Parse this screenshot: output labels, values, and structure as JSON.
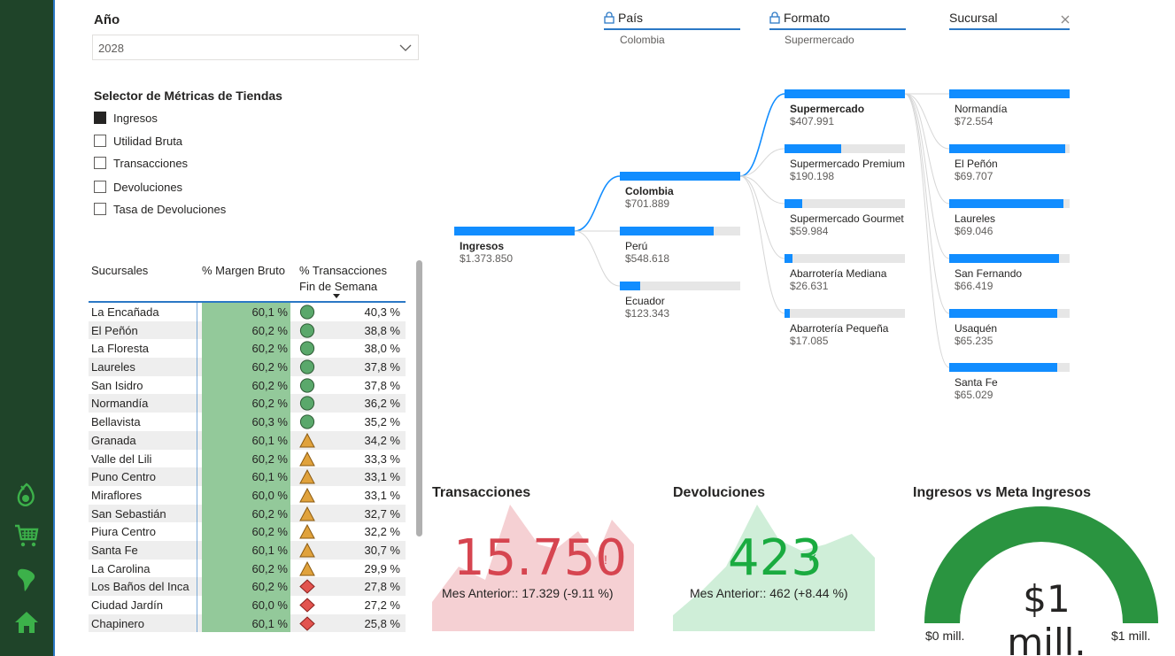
{
  "nav": {
    "items": [
      {
        "name": "avocado-icon"
      },
      {
        "name": "cart-icon"
      },
      {
        "name": "map-south-america-icon"
      },
      {
        "name": "home-icon"
      }
    ]
  },
  "year_filter": {
    "label": "Año",
    "value": "2028"
  },
  "metric_selector": {
    "title": "Selector de Métricas de Tiendas",
    "items": [
      {
        "label": "Ingresos",
        "checked": true
      },
      {
        "label": "Utilidad Bruta",
        "checked": false
      },
      {
        "label": "Transacciones",
        "checked": false
      },
      {
        "label": "Devoluciones",
        "checked": false
      },
      {
        "label": "Tasa de Devoluciones",
        "checked": false
      }
    ]
  },
  "table": {
    "headers": {
      "col1": "Sucursales",
      "col2": "% Margen Bruto",
      "col3a": "% Transacciones",
      "col3b": "Fin de Semana"
    },
    "rows": [
      {
        "name": "La Encañada",
        "margin": "60,1 %",
        "status": "circle",
        "weekend": "40,3 %"
      },
      {
        "name": "El Peñón",
        "margin": "60,2 %",
        "status": "circle",
        "weekend": "38,8 %"
      },
      {
        "name": "La Floresta",
        "margin": "60,2 %",
        "status": "circle",
        "weekend": "38,0 %"
      },
      {
        "name": "Laureles",
        "margin": "60,2 %",
        "status": "circle",
        "weekend": "37,8 %"
      },
      {
        "name": "San Isidro",
        "margin": "60,2 %",
        "status": "circle",
        "weekend": "37,8 %"
      },
      {
        "name": "Normandía",
        "margin": "60,2 %",
        "status": "circle",
        "weekend": "36,2 %"
      },
      {
        "name": "Bellavista",
        "margin": "60,3 %",
        "status": "circle",
        "weekend": "35,2 %"
      },
      {
        "name": "Granada",
        "margin": "60,1 %",
        "status": "triangle",
        "weekend": "34,2 %"
      },
      {
        "name": "Valle del Lili",
        "margin": "60,2 %",
        "status": "triangle",
        "weekend": "33,3 %"
      },
      {
        "name": "Puno Centro",
        "margin": "60,1 %",
        "status": "triangle",
        "weekend": "33,1 %"
      },
      {
        "name": "Miraflores",
        "margin": "60,0 %",
        "status": "triangle",
        "weekend": "33,1 %"
      },
      {
        "name": "San Sebastián",
        "margin": "60,2 %",
        "status": "triangle",
        "weekend": "32,7 %"
      },
      {
        "name": "Piura Centro",
        "margin": "60,2 %",
        "status": "triangle",
        "weekend": "32,2 %"
      },
      {
        "name": "Santa Fe",
        "margin": "60,1 %",
        "status": "triangle",
        "weekend": "30,7 %"
      },
      {
        "name": "La Carolina",
        "margin": "60,2 %",
        "status": "triangle",
        "weekend": "29,9 %"
      },
      {
        "name": "Los Baños del Inca",
        "margin": "60,2 %",
        "status": "diamond",
        "weekend": "27,8 %"
      },
      {
        "name": "Ciudad Jardín",
        "margin": "60,0 %",
        "status": "diamond",
        "weekend": "27,2 %"
      },
      {
        "name": "Chapinero",
        "margin": "60,1 %",
        "status": "diamond",
        "weekend": "25,8 %"
      }
    ]
  },
  "tree": {
    "levels": [
      {
        "title": "País",
        "locked": true,
        "sub": "Colombia"
      },
      {
        "title": "Formato",
        "locked": true,
        "sub": "Supermercado"
      },
      {
        "title": "Sucursal",
        "locked": false,
        "sub": ""
      }
    ],
    "root": {
      "label": "Ingresos",
      "value": "$1.373.850",
      "fraction": 1.0
    },
    "countries": [
      {
        "label": "Colombia",
        "value": "$701.889",
        "fraction": 1.0,
        "selected": true
      },
      {
        "label": "Perú",
        "value": "$548.618",
        "fraction": 0.78,
        "selected": false
      },
      {
        "label": "Ecuador",
        "value": "$123.343",
        "fraction": 0.17,
        "selected": false
      }
    ],
    "formats": [
      {
        "label": "Supermercado",
        "value": "$407.991",
        "fraction": 1.0,
        "selected": true
      },
      {
        "label": "Supermercado Premium",
        "value": "$190.198",
        "fraction": 0.47,
        "selected": false
      },
      {
        "label": "Supermercado Gourmet",
        "value": "$59.984",
        "fraction": 0.15,
        "selected": false
      },
      {
        "label": "Abarrotería Mediana",
        "value": "$26.631",
        "fraction": 0.065,
        "selected": false
      },
      {
        "label": "Abarrotería Pequeña",
        "value": "$17.085",
        "fraction": 0.042,
        "selected": false
      }
    ],
    "stores": [
      {
        "label": "Normandía",
        "value": "$72.554",
        "fraction": 1.0
      },
      {
        "label": "El Peñón",
        "value": "$69.707",
        "fraction": 0.96
      },
      {
        "label": "Laureles",
        "value": "$69.046",
        "fraction": 0.95
      },
      {
        "label": "San Fernando",
        "value": "$66.419",
        "fraction": 0.915
      },
      {
        "label": "Usaquén",
        "value": "$65.235",
        "fraction": 0.9
      },
      {
        "label": "Santa Fe",
        "value": "$65.029",
        "fraction": 0.895
      }
    ]
  },
  "kpis": {
    "transacciones": {
      "title": "Transacciones",
      "value": "15.750",
      "mark": "!",
      "sub": "Mes Anterior:: 17.329 (-9.11 %)",
      "color": "#d64550",
      "bg": "#f5d0d3"
    },
    "devoluciones": {
      "title": "Devoluciones",
      "value": "423",
      "mark": "✓",
      "sub": "Mes Anterior:: 462 (+8.44 %)",
      "color": "#1aab40",
      "bg": "#cfeed8"
    },
    "ingresos_meta": {
      "title": "Ingresos vs Meta Ingresos",
      "value": "$1 mill.",
      "min": "$0 mill.",
      "max": "$1 mill.",
      "fraction": 1.0,
      "color": "#2a9440"
    }
  }
}
